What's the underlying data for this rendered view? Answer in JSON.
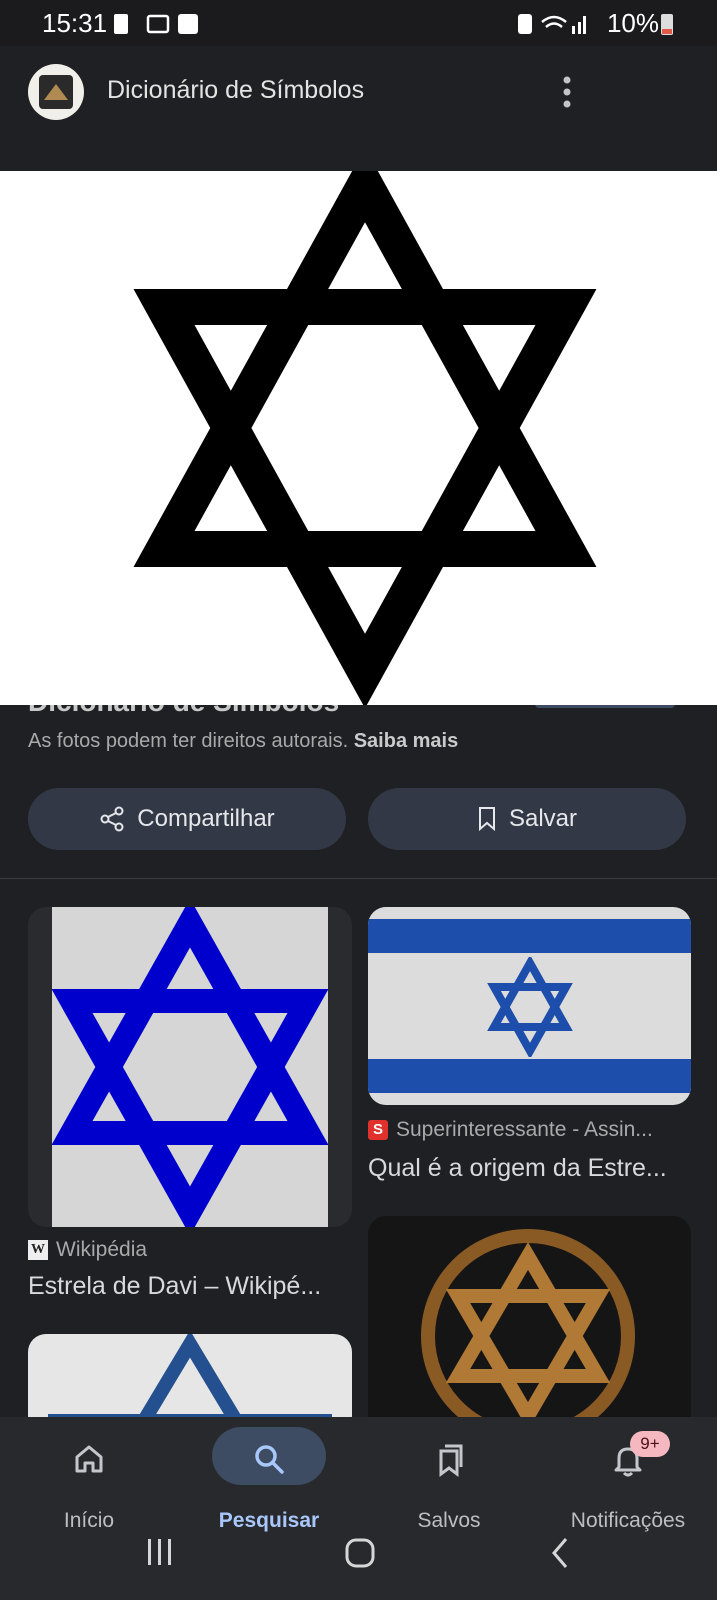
{
  "status_bar": {
    "time": "15:31",
    "battery": "10%"
  },
  "header": {
    "title": "Dicionário de Símbolos"
  },
  "hero": {
    "cut_text": "Dicionário de Símbolos"
  },
  "copyright": {
    "text": "As fotos podem ter direitos autorais.",
    "link": "Saiba mais"
  },
  "actions": {
    "share": "Compartilhar",
    "save": "Salvar"
  },
  "results": [
    {
      "source": "Wikipédia",
      "title": "Estrela de Davi – Wikipé..."
    },
    {
      "source": "Superinteressante - Assin...",
      "title": "Qual é a origem da Estre..."
    }
  ],
  "nav": {
    "items": [
      {
        "label": "Início",
        "icon": "home-icon"
      },
      {
        "label": "Pesquisar",
        "icon": "search-icon"
      },
      {
        "label": "Salvos",
        "icon": "saved-icon"
      },
      {
        "label": "Notificações",
        "icon": "bell-icon"
      }
    ],
    "badge": "9+"
  },
  "colors": {
    "accent": "#a8c7fa",
    "pill": "#323846",
    "background": "#1f2023"
  }
}
